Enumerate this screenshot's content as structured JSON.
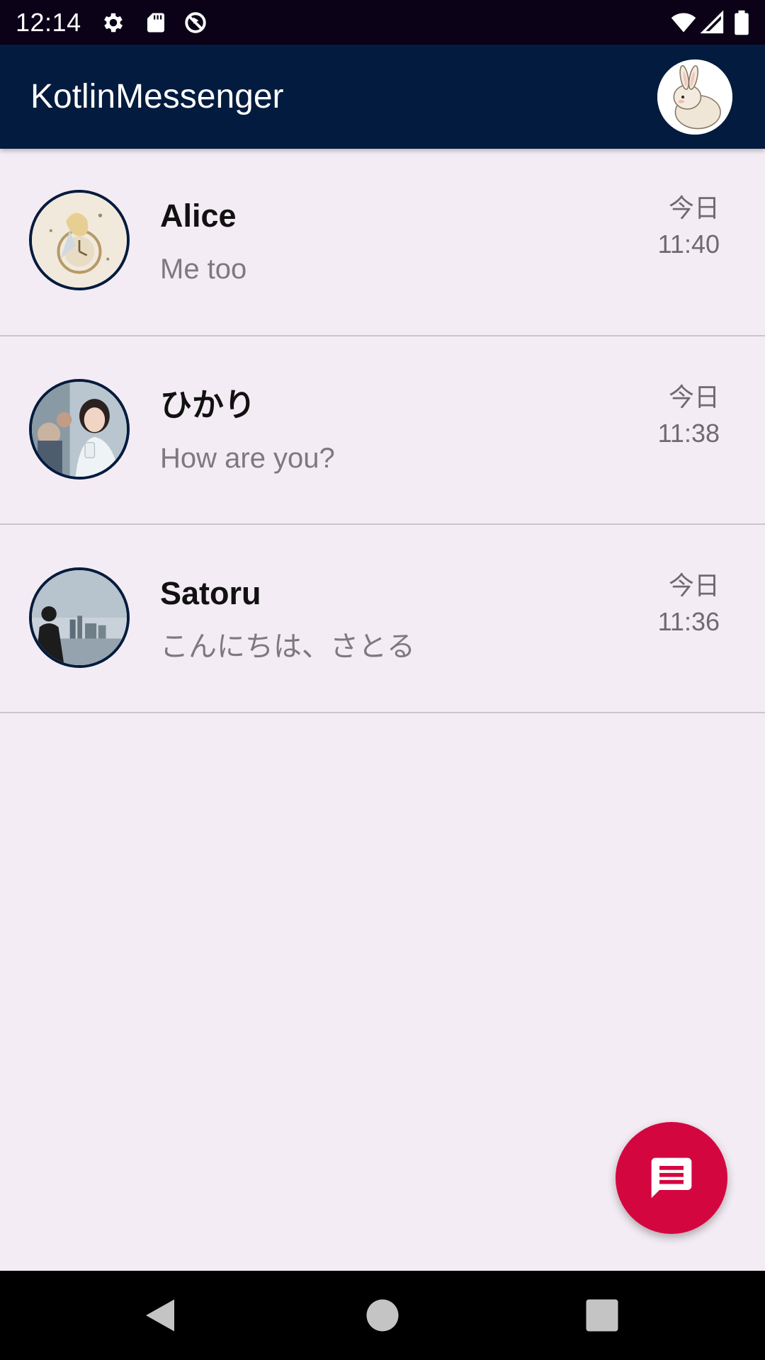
{
  "status_bar": {
    "time": "12:14",
    "icons": [
      "gear-icon",
      "sd-card-icon",
      "sync-off-icon",
      "wifi-icon",
      "signal-icon",
      "battery-icon"
    ]
  },
  "app_bar": {
    "title": "KotlinMessenger",
    "profile_avatar": "rabbit-avatar"
  },
  "conversations": [
    {
      "name": "Alice",
      "preview": "Me too",
      "date": "今日",
      "time": "11:40",
      "avatar": "alice-avatar"
    },
    {
      "name": "ひかり",
      "preview": "How are you?",
      "date": "今日",
      "time": "11:38",
      "avatar": "hikari-avatar"
    },
    {
      "name": "Satoru",
      "preview": "こんにちは、さとる",
      "date": "今日",
      "time": "11:36",
      "avatar": "satoru-avatar"
    }
  ],
  "fab": {
    "icon": "message-icon"
  },
  "nav_bar": {
    "icons": [
      "back-icon",
      "home-icon",
      "recents-icon"
    ]
  },
  "colors": {
    "app_bar": "#031b3e",
    "status_bar": "#0b0218",
    "background": "#f4ecf4",
    "fab": "#d4063f",
    "divider": "#cbc5cc",
    "preview_text": "#7e7880"
  }
}
